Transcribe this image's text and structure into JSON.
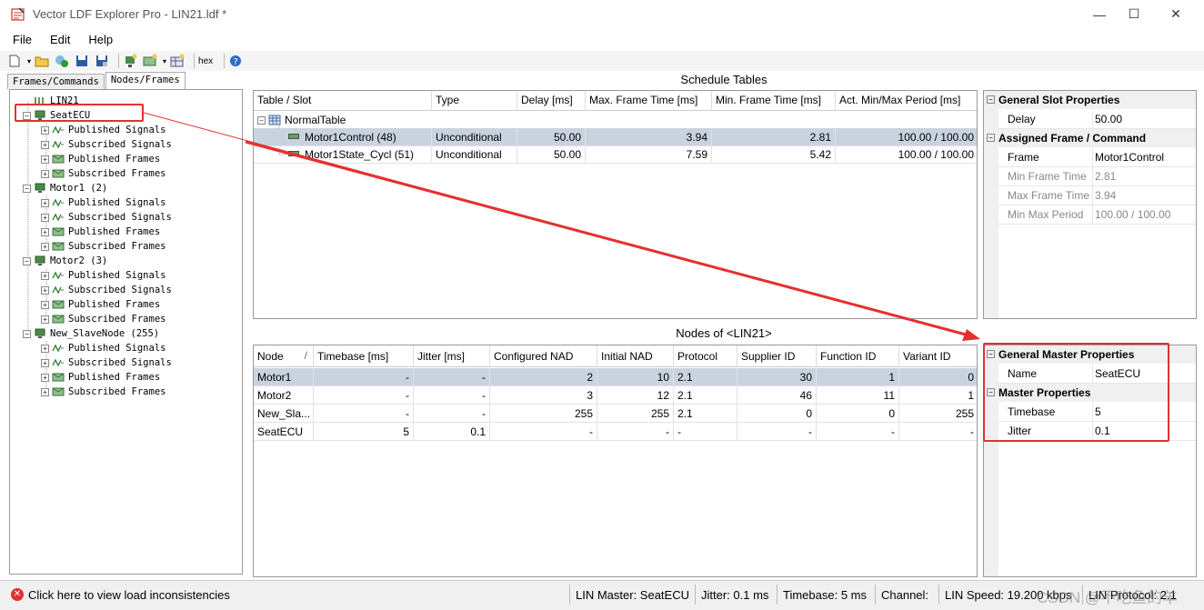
{
  "window": {
    "title": "Vector LDF Explorer Pro - LIN21.ldf *",
    "minimize": "—",
    "maximize": "☐",
    "close": "✕"
  },
  "menu": [
    "File",
    "Edit",
    "Help"
  ],
  "toolbar": {
    "hex_label": "hex"
  },
  "left_tabs": [
    "Frames/Commands",
    "Nodes/Frames"
  ],
  "tree": {
    "root": "LIN21",
    "nodes": [
      {
        "label": "SeatECU",
        "children": [
          "Published Signals",
          "Subscribed Signals",
          "Published Frames",
          "Subscribed Frames"
        ]
      },
      {
        "label": "Motor1 (2)",
        "children": [
          "Published Signals",
          "Subscribed Signals",
          "Published Frames",
          "Subscribed Frames"
        ]
      },
      {
        "label": "Motor2 (3)",
        "children": [
          "Published Signals",
          "Subscribed Signals",
          "Published Frames",
          "Subscribed Frames"
        ]
      },
      {
        "label": "New_SlaveNode (255)",
        "children": [
          "Published Signals",
          "Subscribed Signals",
          "Published Frames",
          "Subscribed Frames"
        ]
      }
    ]
  },
  "schedule": {
    "title": "Schedule Tables",
    "headers": [
      "Table / Slot",
      "Type",
      "Delay [ms]",
      "Max. Frame Time [ms]",
      "Min. Frame Time [ms]",
      "Act. Min/Max Period [ms]"
    ],
    "table_name": "NormalTable",
    "rows": [
      {
        "slot": "Motor1Control (48)",
        "type": "Unconditional",
        "delay": "50.00",
        "max": "3.94",
        "min": "2.81",
        "period": "100.00 / 100.00"
      },
      {
        "slot": "Motor1State_Cycl (51)",
        "type": "Unconditional",
        "delay": "50.00",
        "max": "7.59",
        "min": "5.42",
        "period": "100.00 / 100.00"
      }
    ]
  },
  "slot_props": {
    "cat1": "General Slot Properties",
    "delay_key": "Delay",
    "delay_val": "50.00",
    "cat2": "Assigned Frame / Command",
    "frame_key": "Frame",
    "frame_val": "Motor1Control",
    "minft_key": "Min Frame Time",
    "minft_val": "2.81",
    "maxft_key": "Max Frame Time",
    "maxft_val": "3.94",
    "minmax_key": "Min Max Period",
    "minmax_val": "100.00 / 100.00"
  },
  "nodes": {
    "title": "Nodes of <LIN21>",
    "headers": [
      "Node",
      "Timebase [ms]",
      "Jitter [ms]",
      "Configured NAD",
      "Initial NAD",
      "Protocol",
      "Supplier ID",
      "Function ID",
      "Variant ID"
    ],
    "sort_glyph": "/",
    "rows": [
      [
        "Motor1",
        "-",
        "-",
        "2",
        "10",
        "2.1",
        "30",
        "1",
        "0"
      ],
      [
        "Motor2",
        "-",
        "-",
        "3",
        "12",
        "2.1",
        "46",
        "11",
        "1"
      ],
      [
        "New_Sla...",
        "-",
        "-",
        "255",
        "255",
        "2.1",
        "0",
        "0",
        "255"
      ],
      [
        "SeatECU",
        "5",
        "0.1",
        "-",
        "-",
        "-",
        "-",
        "-",
        "-"
      ]
    ]
  },
  "master_props": {
    "cat1": "General Master Properties",
    "name_key": "Name",
    "name_val": "SeatECU",
    "cat2": "Master Properties",
    "timebase_key": "Timebase",
    "timebase_val": "5",
    "jitter_key": "Jitter",
    "jitter_val": "0.1"
  },
  "status": {
    "inconsistencies": "Click here to view load inconsistencies",
    "master": "LIN Master: SeatECU",
    "jitter": "Jitter: 0.1 ms",
    "timebase": "Timebase: 5 ms",
    "channel": "Channel:",
    "speed": "LIN Speed: 19.200 kbps",
    "protocol": "LIN Protocol: 2.1",
    "watermark": "CSDN @不吃鱼的羊"
  },
  "colors": {
    "highlight": "#e53030",
    "selection": "#c9d3e0"
  }
}
